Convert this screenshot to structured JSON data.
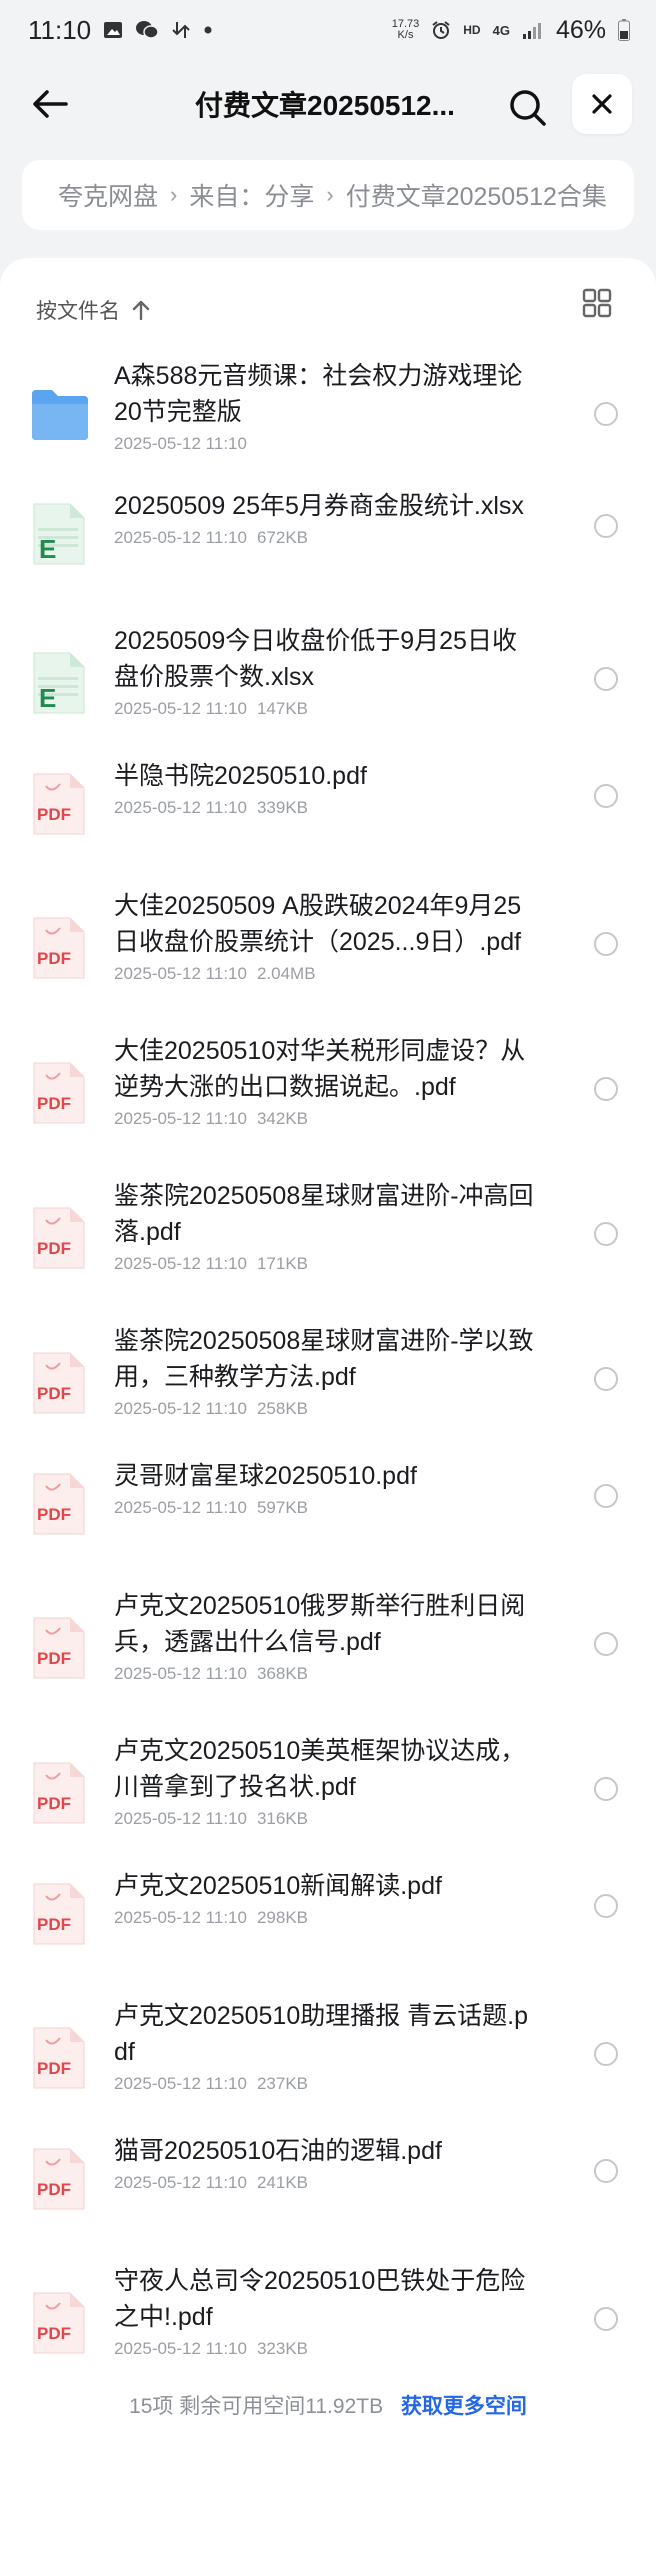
{
  "status_bar": {
    "time": "11:10",
    "speed_value": "17.73",
    "speed_unit": "K/s",
    "network_hd": "HD",
    "network_type": "4G",
    "battery": "46%",
    "left_icons": [
      "gallery-icon",
      "wechat-icon",
      "download-icon",
      "dot-icon"
    ],
    "right_icons": [
      "alarm-icon",
      "signal-icon",
      "battery-icon"
    ]
  },
  "header": {
    "title": "付费文章20250512..."
  },
  "breadcrumb": {
    "items": [
      "夸克网盘",
      "来自：分享",
      "付费文章20250512合集"
    ]
  },
  "sort": {
    "label": "按文件名"
  },
  "files": [
    {
      "type": "folder",
      "name": "A森588元音频课：社会权力游戏理论20节完整版",
      "date": "2025-05-12 11:10",
      "size": ""
    },
    {
      "type": "xlsx",
      "name": "20250509 25年5月券商金股统计.xlsx",
      "date": "2025-05-12 11:10",
      "size": "672KB"
    },
    {
      "type": "xlsx",
      "name": "20250509今日收盘价低于9月25日收盘价股票个数.xlsx",
      "date": "2025-05-12 11:10",
      "size": "147KB"
    },
    {
      "type": "pdf",
      "name": "半隐书院20250510.pdf",
      "date": "2025-05-12 11:10",
      "size": "339KB"
    },
    {
      "type": "pdf",
      "name": "大佳20250509 A股跌破2024年9月25日收盘价股票统计（2025...9日）.pdf",
      "date": "2025-05-12 11:10",
      "size": "2.04MB"
    },
    {
      "type": "pdf",
      "name": "大佳20250510对华关税形同虚设？从逆势大涨的出口数据说起。.pdf",
      "date": "2025-05-12 11:10",
      "size": "342KB"
    },
    {
      "type": "pdf",
      "name": "鉴茶院20250508星球财富进阶-冲高回落.pdf",
      "date": "2025-05-12 11:10",
      "size": "171KB"
    },
    {
      "type": "pdf",
      "name": "鉴茶院20250508星球财富进阶-学以致用，三种教学方法.pdf",
      "date": "2025-05-12 11:10",
      "size": "258KB"
    },
    {
      "type": "pdf",
      "name": "灵哥财富星球20250510.pdf",
      "date": "2025-05-12 11:10",
      "size": "597KB"
    },
    {
      "type": "pdf",
      "name": "卢克文20250510俄罗斯举行胜利日阅兵，透露出什么信号.pdf",
      "date": "2025-05-12 11:10",
      "size": "368KB"
    },
    {
      "type": "pdf",
      "name": "卢克文20250510美英框架协议达成，川普拿到了投名状.pdf",
      "date": "2025-05-12 11:10",
      "size": "316KB"
    },
    {
      "type": "pdf",
      "name": "卢克文20250510新闻解读.pdf",
      "date": "2025-05-12 11:10",
      "size": "298KB"
    },
    {
      "type": "pdf",
      "name": "卢克文20250510助理播报 青云话题.pdf",
      "date": "2025-05-12 11:10",
      "size": "237KB"
    },
    {
      "type": "pdf",
      "name": "猫哥20250510石油的逻辑.pdf",
      "date": "2025-05-12 11:10",
      "size": "241KB"
    },
    {
      "type": "pdf",
      "name": "守夜人总司令20250510巴铁处于危险之中!.pdf",
      "date": "2025-05-12 11:10",
      "size": "323KB"
    }
  ],
  "icon_labels": {
    "xlsx": "E",
    "pdf": "PDF"
  },
  "footer": {
    "summary": "15项 剩余可用空间11.92TB",
    "link": "获取更多空间"
  },
  "colors": {
    "accent": "#2467e8",
    "folder": "#5ba4ef",
    "excel": "#1f8b4c",
    "pdf": "#e0464a"
  }
}
